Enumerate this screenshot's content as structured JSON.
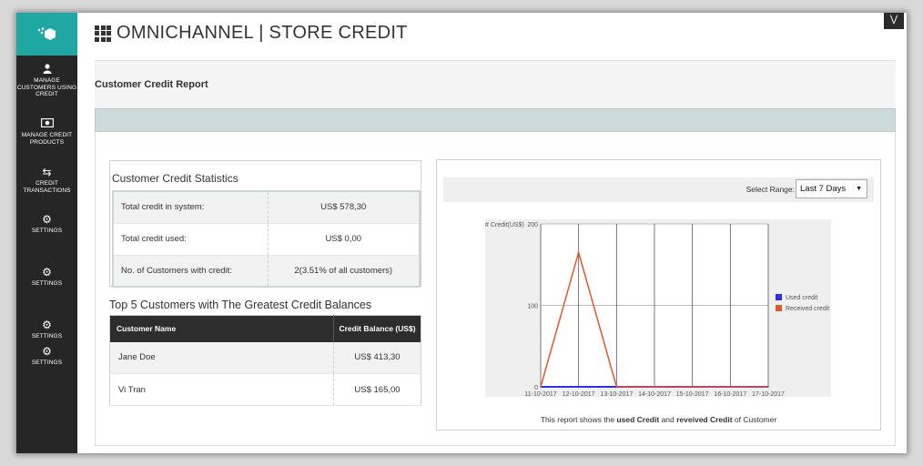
{
  "app": {
    "title": "OMNICHANNEL | STORE CREDIT",
    "collapse_icon": "double-chevron-down-icon"
  },
  "sidebar": {
    "items": [
      {
        "icon": "user-icon",
        "label": "MANAGE CUSTOMERS USING CREDIT"
      },
      {
        "icon": "money-icon",
        "label": "MANAGE CREDIT PRODUCTS"
      },
      {
        "icon": "transfer-arrows-icon",
        "label": "CREDIT TRANSACTIONS"
      },
      {
        "icon": "gear-icon",
        "label": "SETTINGS"
      },
      {
        "icon": "gear-icon",
        "label": "SETTINGS"
      },
      {
        "icon": "gear-icon",
        "label": "SETTINGS"
      },
      {
        "icon": "gear-icon",
        "label": "SETTINGS"
      }
    ]
  },
  "report": {
    "title": "Customer Credit Report"
  },
  "stats": {
    "title": "Customer Credit Statistics",
    "rows": [
      {
        "label": "Total credit in system:",
        "value": "US$ 578,30"
      },
      {
        "label": "Total credit used:",
        "value": "US$ 0,00"
      },
      {
        "label": "No. of Customers with credit:",
        "value": "2(3.51% of all customers)"
      }
    ]
  },
  "top5": {
    "title": "Top 5 Customers with The Greatest Credit Balances",
    "headers": {
      "name": "Customer Name",
      "balance": "Credit Balance (US$)"
    },
    "rows": [
      {
        "name": "Jane Doe",
        "balance": "US$ 413,30"
      },
      {
        "name": "Vi Tran",
        "balance": "US$ 165,00"
      }
    ]
  },
  "range": {
    "label": "Select Range:",
    "selected": "Last 7 Days"
  },
  "chart_data": {
    "type": "line",
    "ylabel": "# Credit(US$)",
    "ylim": [
      0,
      200
    ],
    "yticks": [
      0,
      100,
      200
    ],
    "x": [
      "11-10-2017",
      "12-10-2017",
      "13-10-2017",
      "14-10-2017",
      "15-10-2017",
      "16-10-2017",
      "17-10-2017"
    ],
    "series": [
      {
        "name": "Used credit",
        "color": "#2f2fe8",
        "values": [
          0,
          0,
          0,
          0,
          0,
          0,
          0
        ]
      },
      {
        "name": "Received credit",
        "color": "#e2572b",
        "values": [
          0,
          165,
          0,
          0,
          0,
          0,
          0
        ]
      }
    ],
    "legend": "right",
    "grid": true
  },
  "caption": {
    "pre": "This report shows the ",
    "used": "used Credit",
    "mid": " and ",
    "received": "reveived Credit",
    "post": " of Customer"
  }
}
